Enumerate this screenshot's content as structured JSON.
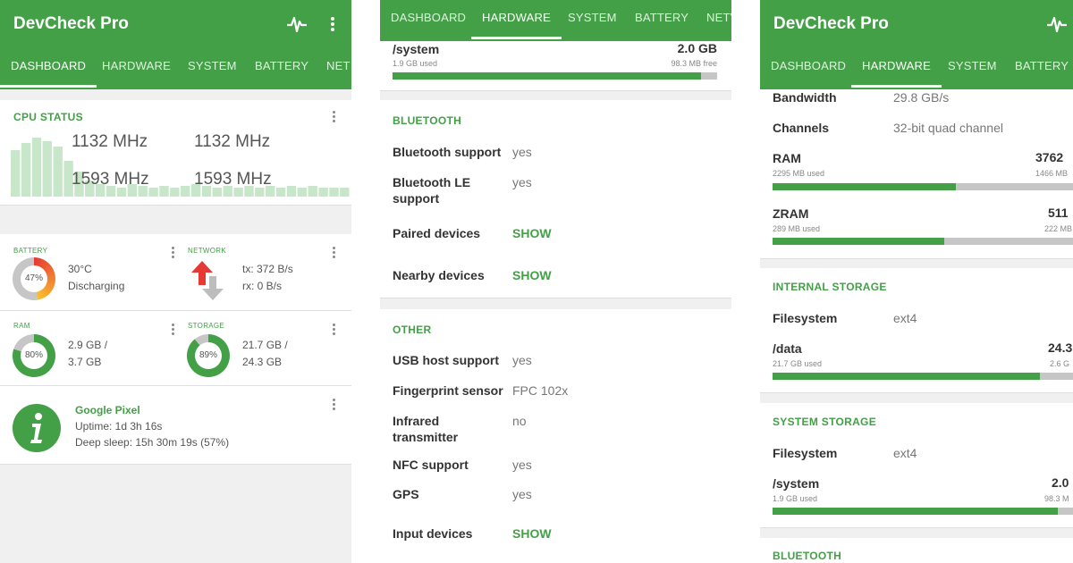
{
  "app": {
    "title": "DevCheck Pro"
  },
  "tabs": [
    "DASHBOARD",
    "HARDWARE",
    "SYSTEM",
    "BATTERY",
    "NETWORK"
  ],
  "tabs_truncated": {
    "network_short": "NET",
    "network_short2": "NETV"
  },
  "colors": {
    "accent": "#43a047",
    "track": "#c6c6c6",
    "battery_ring_start": "#e53935",
    "battery_ring_end": "#fbc02d"
  },
  "panel1": {
    "active_tab": "DASHBOARD",
    "cpu": {
      "title": "CPU STATUS",
      "freqs": [
        "1132 MHz",
        "1132 MHz",
        "1593 MHz",
        "1593 MHz"
      ]
    },
    "battery": {
      "title": "BATTERY",
      "percent": "47%",
      "percent_value": 47,
      "temp": "30°C",
      "status": "Discharging"
    },
    "network": {
      "title": "NETWORK",
      "tx": "tx: 372 B/s",
      "rx": "rx: 0 B/s"
    },
    "ram": {
      "title": "RAM",
      "percent": "80%",
      "percent_value": 80,
      "line1": "2.9 GB /",
      "line2": "3.7 GB"
    },
    "storage": {
      "title": "STORAGE",
      "percent": "89%",
      "percent_value": 89,
      "line1": "21.7 GB /",
      "line2": "24.3 GB"
    },
    "device": {
      "name": "Google Pixel",
      "uptime": "Uptime: 1d 3h 16s",
      "deep_sleep": "Deep sleep: 15h 30m 19s (57%)"
    }
  },
  "panel2": {
    "active_tab": "HARDWARE",
    "system_storage": {
      "path": "/system",
      "size": "2.0 GB",
      "used": "1.9 GB used",
      "free": "98.3 MB free",
      "fill": 0.95
    },
    "bluetooth": {
      "title": "BLUETOOTH",
      "rows": [
        {
          "label": "Bluetooth support",
          "value": "yes"
        },
        {
          "label": "Bluetooth LE",
          "label2": "support",
          "value": "yes"
        },
        {
          "label": "Paired devices",
          "value": "SHOW"
        },
        {
          "label": "Nearby devices",
          "value": "SHOW"
        }
      ]
    },
    "other": {
      "title": "OTHER",
      "rows": [
        {
          "label": "USB host support",
          "value": "yes"
        },
        {
          "label": "Fingerprint sensor",
          "value": "FPC 102x"
        },
        {
          "label": "Infrared",
          "label2": "transmitter",
          "value": "no"
        },
        {
          "label": "NFC support",
          "value": "yes"
        },
        {
          "label": "GPS",
          "value": "yes"
        },
        {
          "label": "Input devices",
          "value": "SHOW"
        }
      ]
    }
  },
  "panel3": {
    "active_tab": "HARDWARE",
    "memory": {
      "bandwidth_label": "Bandwidth",
      "bandwidth_value": "29.8 GB/s",
      "channels_label": "Channels",
      "channels_value": "32-bit quad channel",
      "ram_label": "RAM",
      "ram_used": "2295 MB used",
      "ram_total": "3762",
      "ram_free": "1466 MB",
      "ram_fill": 0.61,
      "zram_label": "ZRAM",
      "zram_used": "289 MB used",
      "zram_total": "511",
      "zram_free": "222 MB",
      "zram_fill": 0.57
    },
    "internal_storage": {
      "title": "INTERNAL STORAGE",
      "fs_label": "Filesystem",
      "fs_value": "ext4",
      "path": "/data",
      "used": "21.7 GB used",
      "total": "24.3",
      "free": "2.6 G",
      "fill": 0.89
    },
    "system_storage": {
      "title": "SYSTEM STORAGE",
      "fs_label": "Filesystem",
      "fs_value": "ext4",
      "path": "/system",
      "used": "1.9 GB used",
      "total": "2.0",
      "free": "98.3 M",
      "fill": 0.95
    },
    "bluetooth_title": "BLUETOOTH"
  }
}
